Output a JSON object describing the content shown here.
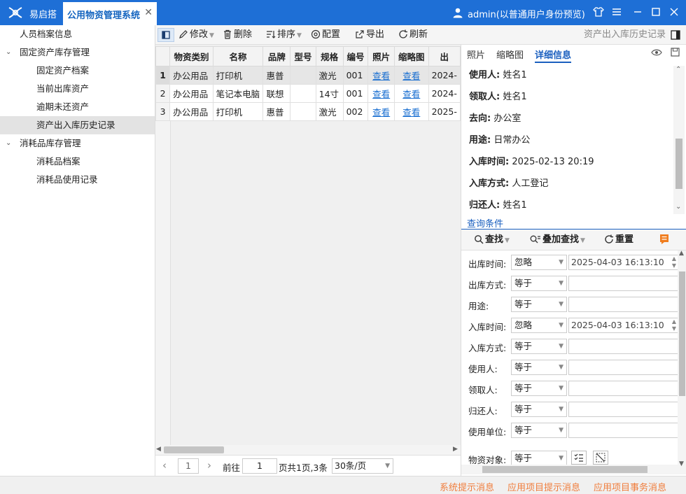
{
  "titlebar": {
    "app_name": "易启搭",
    "tab_label": "公用物资管理系统",
    "tab_close": "✕",
    "username": "admin(以普通用户身份预览)"
  },
  "sidebar": {
    "items": [
      {
        "label": "人员档案信息"
      },
      {
        "label": "固定资产库存管理",
        "arrow": "⌄"
      },
      {
        "label": "固定资产档案"
      },
      {
        "label": "当前出库资产"
      },
      {
        "label": "逾期未还资产"
      },
      {
        "label": "资产出入库历史记录"
      },
      {
        "label": "消耗品库存管理",
        "arrow": "⌄"
      },
      {
        "label": "消耗品档案"
      },
      {
        "label": "消耗品使用记录"
      }
    ]
  },
  "toolbar": {
    "modify": "修改",
    "delete": "删除",
    "sort": "排序",
    "config": "配置",
    "export": "导出",
    "refresh": "刷新",
    "breadcrumb": "资产出入库历史记录"
  },
  "table": {
    "headers": [
      "物资类别",
      "名称",
      "品牌",
      "型号",
      "规格",
      "编号",
      "照片",
      "缩略图",
      "出"
    ],
    "rows": [
      {
        "num": "1",
        "cells": [
          "办公用品",
          "打印机",
          "惠普",
          "",
          "激光",
          "001",
          "查看",
          "查看",
          "2024-"
        ]
      },
      {
        "num": "2",
        "cells": [
          "办公用品",
          "笔记本电脑",
          "联想",
          "",
          "14寸",
          "001",
          "查看",
          "查看",
          "2024-"
        ]
      },
      {
        "num": "3",
        "cells": [
          "办公用品",
          "打印机",
          "惠普",
          "",
          "激光",
          "002",
          "查看",
          "查看",
          "2025-"
        ]
      }
    ]
  },
  "pager": {
    "current_page": "1",
    "goto_label": "前往",
    "goto_value": "1",
    "summary": "页共1页,3条",
    "page_size": "30条/页"
  },
  "detail": {
    "tabs": [
      "照片",
      "缩略图",
      "详细信息"
    ],
    "fields": [
      {
        "label": "使用人:",
        "value": "姓名1"
      },
      {
        "label": "领取人:",
        "value": "姓名1"
      },
      {
        "label": "去向:",
        "value": "办公室"
      },
      {
        "label": "用途:",
        "value": "日常办公"
      },
      {
        "label": "入库时间:",
        "value": "2025-02-13 20:19"
      },
      {
        "label": "入库方式:",
        "value": "人工登记"
      },
      {
        "label": "归还人:",
        "value": "姓名1"
      }
    ]
  },
  "query": {
    "tab": "查询条件",
    "find": "查找",
    "add_find": "叠加查找",
    "reset": "重置",
    "rows": [
      {
        "label": "出库时间:",
        "op": "忽略",
        "value": "2025-04-03 16:13:10"
      },
      {
        "label": "出库方式:",
        "op": "等于",
        "value": ""
      },
      {
        "label": "用途:",
        "op": "等于",
        "value": ""
      },
      {
        "label": "入库时间:",
        "op": "忽略",
        "value": "2025-04-03 16:13:10"
      },
      {
        "label": "入库方式:",
        "op": "等于",
        "value": ""
      },
      {
        "label": "使用人:",
        "op": "等于",
        "value": ""
      },
      {
        "label": "领取人:",
        "op": "等于",
        "value": ""
      },
      {
        "label": "归还人:",
        "op": "等于",
        "value": ""
      },
      {
        "label": "使用单位:",
        "op": "等于",
        "value": ""
      },
      {
        "label": "物资对象:",
        "op": "等于",
        "value": ""
      }
    ]
  },
  "statusbar": {
    "links": [
      "系统提示消息",
      "应用项目提示消息",
      "应用项目事务消息"
    ]
  },
  "colors": {
    "title_blue": "#1e6fd6",
    "link_blue": "#1a6fd1",
    "status_orange": "#f07d3c",
    "active_tab_blue": "#1a5fbf"
  }
}
